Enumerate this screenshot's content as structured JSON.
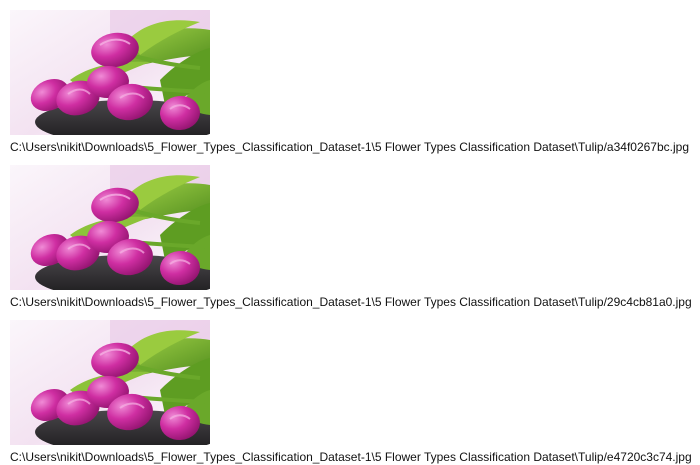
{
  "images": [
    {
      "image_alt": "tulip-photo",
      "caption": "C:\\Users\\nikit\\Downloads\\5_Flower_Types_Classification_Dataset-1\\5 Flower Types Classification Dataset\\Tulip/a34f0267bc.jpg"
    },
    {
      "image_alt": "tulip-photo",
      "caption": "C:\\Users\\nikit\\Downloads\\5_Flower_Types_Classification_Dataset-1\\5 Flower Types Classification Dataset\\Tulip/29c4cb81a0.jpg"
    },
    {
      "image_alt": "tulip-photo",
      "caption": "C:\\Users\\nikit\\Downloads\\5_Flower_Types_Classification_Dataset-1\\5 Flower Types Classification Dataset\\Tulip/e4720c3c74.jpg"
    }
  ],
  "colors": {
    "tulip_petal": "#c0208f",
    "tulip_highlight": "#e77ac8",
    "leaf": "#7fb82e",
    "leaf_dark": "#4e8a1c",
    "bowl": "#2b2a2c",
    "background_top": "#f6e9f5",
    "background_bottom": "#fbfbfb"
  }
}
